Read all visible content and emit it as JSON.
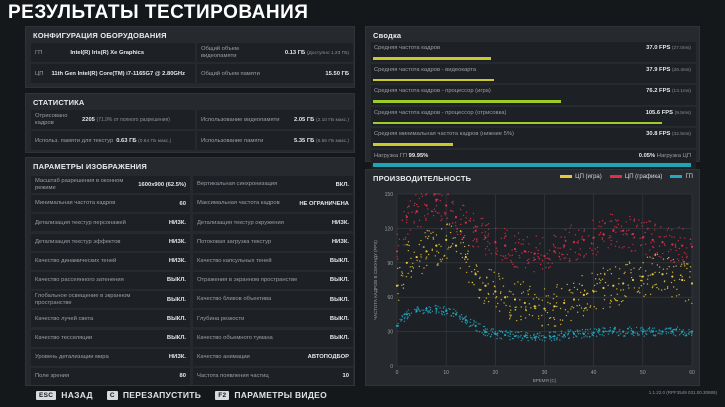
{
  "title": "РЕЗУЛЬТАТЫ ТЕСТИРОВАНИЯ",
  "hardware": {
    "heading": "КОНФИГУРАЦИЯ ОБОРУДОВАНИЯ",
    "gpu_label": "ГП",
    "gpu_value": "Intel(R) Iris(R) Xe Graphics",
    "vram_label": "Общий объем видеопамяти",
    "vram_value": "0.13 ГБ",
    "vram_avail": "(Доступно 1.23 ГБ)",
    "cpu_label": "ЦП",
    "cpu_value": "11th Gen Intel(R) Core(TM) i7-1165G7 @ 2.80GHz",
    "ram_label": "Общий объем памяти",
    "ram_value": "15.50 ГБ"
  },
  "stats": {
    "heading": "СТАТИСТИКА",
    "rendered_label": "Отрисовано кадров",
    "rendered_value": "2205",
    "rendered_note": "(71.9% от полного разрешения)",
    "vram_usage_label": "Использование видеопамяти",
    "vram_usage_value": "2.05 ГБ",
    "vram_usage_note": "(2.10 ГБ макс.)",
    "tex_mem_label": "Использ. памяти для текстур",
    "tex_mem_value": "0.63 ГБ",
    "tex_mem_note": "(0.64 ГБ макс.)",
    "mem_usage_label": "Использование памяти",
    "mem_usage_value": "5.35 ГБ",
    "mem_usage_note": "(5.56 ГБ макс.)"
  },
  "params": {
    "heading": "ПАРАМЕТРЫ ИЗОБРАЖЕНИЯ",
    "rows": [
      {
        "l1": "Масштаб разрешения в оконном режиме",
        "v1": "1600x900 (62.5%)",
        "l2": "Вертикальная синхронизация",
        "v2": "ВКЛ."
      },
      {
        "l1": "Минимальная частота кадров",
        "v1": "60",
        "l2": "Максимальная частота кадров",
        "v2": "НЕ ОГРАНИЧЕНА"
      },
      {
        "l1": "Детализация текстур персонажей",
        "v1": "НИЗК.",
        "l2": "Детализация текстур окружения",
        "v2": "НИЗК."
      },
      {
        "l1": "Детализация текстур эффектов",
        "v1": "НИЗК.",
        "l2": "Потоковая загрузка текстур",
        "v2": "НИЗК."
      },
      {
        "l1": "Качество динамических теней",
        "v1": "НИЗК.",
        "l2": "Качество капсульных теней",
        "v2": "ВЫКЛ."
      },
      {
        "l1": "Качество рассеянного затенения",
        "v1": "ВЫКЛ.",
        "l2": "Отражения в экранном пространстве",
        "v2": "ВЫКЛ."
      },
      {
        "l1": "Глобальное освещение в экранном пространстве",
        "v1": "ВЫКЛ.",
        "l2": "Качество бликов объектива",
        "v2": "ВЫКЛ."
      },
      {
        "l1": "Качество лучей света",
        "v1": "ВЫКЛ.",
        "l2": "Глубина резкости",
        "v2": "ВЫКЛ."
      },
      {
        "l1": "Качество тесселяции",
        "v1": "ВЫКЛ.",
        "l2": "Качество объемного тумана",
        "v2": "ВЫКЛ."
      },
      {
        "l1": "Уровень детализации мира",
        "v1": "НИЗК.",
        "l2": "Качество анимации",
        "v2": "АВТОПОДБОР"
      },
      {
        "l1": "Поле зрения",
        "v1": "80",
        "l2": "Частота появления частиц",
        "v2": "10"
      }
    ]
  },
  "summary": {
    "heading": "Сводка",
    "rows": [
      {
        "label": "Средняя частота кадров",
        "value": "37.0 FPS",
        "note": "(27.0ms)",
        "bar": 0.37,
        "color": "#c9c92a"
      },
      {
        "label": "Средняя частота кадров - видеокарта",
        "value": "37.9 FPS",
        "note": "(26.4ms)",
        "bar": 0.38,
        "color": "#c9c92a"
      },
      {
        "label": "Средняя частота кадров - процессор (игра)",
        "value": "76.2 FPS",
        "note": "(13.1ms)",
        "bar": 0.59,
        "color": "#9ccb2a"
      },
      {
        "label": "Средняя частота кадров - процессор (отрисовка)",
        "value": "105.6 FPS",
        "note": "(9.5ms)",
        "bar": 0.91,
        "color": "#9ccb2a"
      },
      {
        "label": "Средняя минимальная частота кадров (нижние 5%)",
        "value": "30.8 FPS",
        "note": "(32.5ms)",
        "bar": 0.25,
        "color": "#c9c92a"
      }
    ],
    "load_gpu_label": "Нагрузка ГП",
    "load_gpu_value": "99.95%",
    "load_cpu_value": "0.05%",
    "load_cpu_label": "Нагрузка ЦП",
    "load_fraction": 0.9995,
    "load_color": "#1fa3b5"
  },
  "perf": {
    "heading": "ПРОИЗВОДИТЕЛЬНОСТЬ",
    "legend": [
      {
        "name": "ЦП (игра)",
        "color": "#e8c93a"
      },
      {
        "name": "ЦП (графика)",
        "color": "#e0304a"
      },
      {
        "name": "ГП",
        "color": "#22a8c0"
      }
    ]
  },
  "chart_data": {
    "type": "scatter",
    "xlabel": "ВРЕМЯ (С)",
    "ylabel": "ЧАСТОТА КАДРОВ В СЕКУНДУ (FPS)",
    "xlim": [
      0,
      60
    ],
    "ylim": [
      0,
      150
    ],
    "xticks": [
      "0",
      "10",
      "20",
      "30",
      "40",
      "50",
      "60"
    ],
    "yticks": [
      "0",
      "30",
      "60",
      "90",
      "120",
      "150"
    ],
    "grid": true,
    "legend_position": "top-right",
    "series": [
      {
        "name": "ЦП (игра)",
        "x": [
          0,
          2,
          4,
          6,
          8,
          10,
          12,
          14,
          16,
          18,
          20,
          22,
          24,
          26,
          28,
          30,
          32,
          34,
          36,
          38,
          40,
          42,
          44,
          46,
          48,
          50,
          52,
          54,
          56,
          58,
          60
        ],
        "y": [
          70,
          90,
          95,
          100,
          105,
          110,
          105,
          95,
          80,
          70,
          65,
          60,
          58,
          55,
          52,
          50,
          52,
          55,
          58,
          62,
          65,
          68,
          70,
          72,
          75,
          78,
          80,
          80,
          78,
          75,
          72
        ]
      },
      {
        "name": "ЦП (графика)",
        "x": [
          0,
          2,
          4,
          6,
          8,
          10,
          12,
          14,
          16,
          18,
          20,
          22,
          24,
          26,
          28,
          30,
          32,
          34,
          36,
          38,
          40,
          42,
          44,
          46,
          48,
          50,
          52,
          54,
          56,
          58,
          60
        ],
        "y": [
          100,
          130,
          135,
          140,
          145,
          140,
          130,
          125,
          118,
          112,
          108,
          105,
          102,
          100,
          98,
          96,
          100,
          105,
          108,
          110,
          112,
          115,
          118,
          118,
          115,
          112,
          110,
          108,
          106,
          105,
          104
        ]
      },
      {
        "name": "ГП",
        "x": [
          0,
          2,
          4,
          6,
          8,
          10,
          12,
          14,
          16,
          18,
          20,
          22,
          24,
          26,
          28,
          30,
          32,
          34,
          36,
          38,
          40,
          42,
          44,
          46,
          48,
          50,
          52,
          54,
          56,
          58,
          60
        ],
        "y": [
          35,
          45,
          48,
          50,
          50,
          48,
          45,
          40,
          35,
          30,
          28,
          27,
          26,
          26,
          25,
          25,
          26,
          27,
          28,
          28,
          29,
          30,
          30,
          30,
          30,
          30,
          30,
          30,
          30,
          30,
          30
        ]
      }
    ]
  },
  "footer": {
    "back_key": "ESC",
    "back_label": "НАЗАД",
    "restart_key": "C",
    "restart_label": "ПЕРЕЗАПУСТИТЬ",
    "video_key": "F2",
    "video_label": "ПАРАМЕТРЫ ВИДЕО"
  },
  "version": "1.1.22.0 (RPF3549 031.00.30889)"
}
